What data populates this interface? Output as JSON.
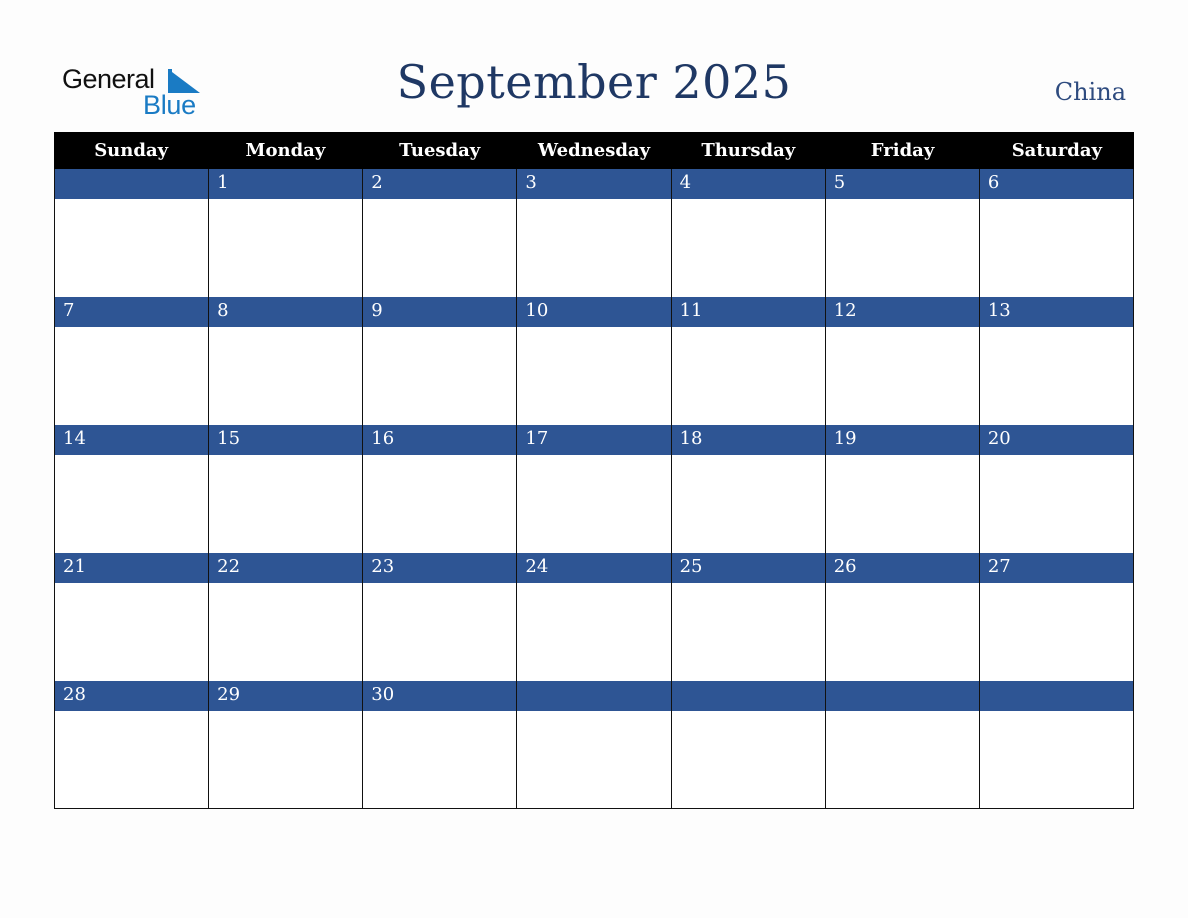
{
  "logo": {
    "line1": "General",
    "line2": "Blue",
    "icon": "triangle-flag-icon",
    "brand_color": "#1a7bc4"
  },
  "header": {
    "title": "September 2025",
    "country": "China"
  },
  "colors": {
    "title": "#1f3864",
    "header_bg": "#000000",
    "date_band": "#2e5594",
    "grid_lines": "#111111"
  },
  "calendar": {
    "weekdays": [
      "Sunday",
      "Monday",
      "Tuesday",
      "Wednesday",
      "Thursday",
      "Friday",
      "Saturday"
    ],
    "weeks": [
      [
        "",
        "1",
        "2",
        "3",
        "4",
        "5",
        "6"
      ],
      [
        "7",
        "8",
        "9",
        "10",
        "11",
        "12",
        "13"
      ],
      [
        "14",
        "15",
        "16",
        "17",
        "18",
        "19",
        "20"
      ],
      [
        "21",
        "22",
        "23",
        "24",
        "25",
        "26",
        "27"
      ],
      [
        "28",
        "29",
        "30",
        "",
        "",
        "",
        ""
      ]
    ]
  }
}
